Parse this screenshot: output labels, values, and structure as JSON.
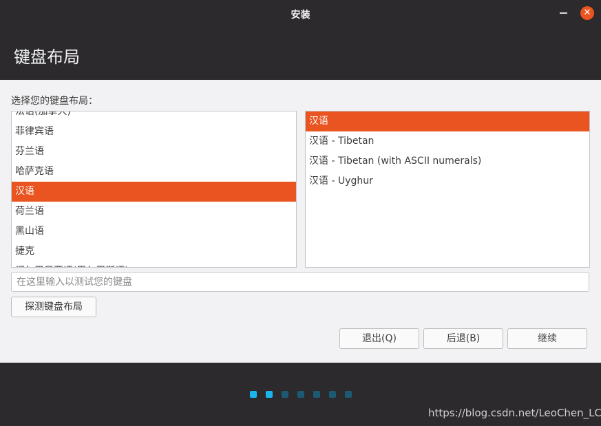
{
  "window": {
    "title": "安装"
  },
  "header": {
    "title": "键盘布局"
  },
  "content": {
    "prompt": "选择您的键盘布局：",
    "layouts": [
      "法语(加拿大)",
      "菲律宾语",
      "芬兰语",
      "哈萨克语",
      "汉语",
      "荷兰语",
      "黑山语",
      "捷克",
      "门尔巴尼亚语(巴尔巴斯语)"
    ],
    "selected_layout": "汉语",
    "variants": [
      "汉语",
      "汉语 - Tibetan",
      "汉语 - Tibetan (with ASCII numerals)",
      "汉语 - Uyghur"
    ],
    "selected_variant": "汉语",
    "test_placeholder": "在这里输入以测试您的键盘",
    "detect_label": "探测键盘布局"
  },
  "buttons": {
    "quit": "退出(Q)",
    "back": "后退(B)",
    "continue": "继续"
  },
  "progress": {
    "total_steps": 7,
    "current_step": 2
  },
  "watermark": "https://blog.csdn.net/LeoChen_LC",
  "colors": {
    "accent": "#e95420",
    "dark": "#2c2a2d",
    "dot_active": "#19b6ee",
    "dot_inactive": "#1c5a73"
  }
}
